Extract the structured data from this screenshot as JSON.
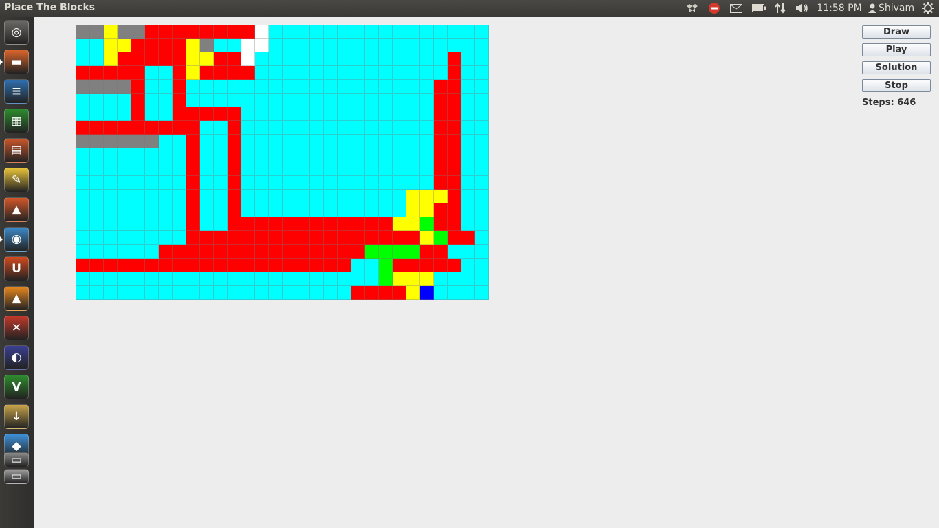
{
  "window": {
    "title": "Place The Blocks"
  },
  "tray": {
    "time": "11:58 PM",
    "user": "Shivam",
    "icons": [
      "dropbox-icon",
      "stop-icon",
      "mail-icon",
      "battery-icon",
      "network-icon",
      "volume-icon",
      "user-icon",
      "power-icon"
    ]
  },
  "launcher": {
    "apps": [
      {
        "name": "dash-home",
        "glyph": "◎",
        "color": "#6b6a66"
      },
      {
        "name": "files",
        "glyph": "▬",
        "color": "#d9642b"
      },
      {
        "name": "libreoffice-writer",
        "glyph": "≡",
        "color": "#2f6fb0"
      },
      {
        "name": "libreoffice-calc",
        "glyph": "▦",
        "color": "#2e8b2e"
      },
      {
        "name": "libreoffice-impress",
        "glyph": "▤",
        "color": "#c8562a"
      },
      {
        "name": "sticky-notes",
        "glyph": "✎",
        "color": "#e6c23a"
      },
      {
        "name": "software-center",
        "glyph": "▲",
        "color": "#d3582a"
      },
      {
        "name": "chromium",
        "glyph": "◉",
        "color": "#3c8ac9"
      },
      {
        "name": "ubuntu-one",
        "glyph": "U",
        "color": "#d04a1f"
      },
      {
        "name": "vlc",
        "glyph": "▲",
        "color": "#e8871e"
      },
      {
        "name": "system-settings",
        "glyph": "✕",
        "color": "#c0392b"
      },
      {
        "name": "eclipse",
        "glyph": "◐",
        "color": "#3a3f8f"
      },
      {
        "name": "vim",
        "glyph": "V",
        "color": "#2e8b2e"
      },
      {
        "name": "archive-manager",
        "glyph": "↓",
        "color": "#c9a44a"
      },
      {
        "name": "dropbox",
        "glyph": "◆",
        "color": "#3d8fd6"
      },
      {
        "name": "terminal",
        "glyph": "▭",
        "color": "#8a8a8a"
      },
      {
        "name": "text-editor",
        "glyph": "▭",
        "color": "#a0a0a0"
      }
    ]
  },
  "palette": {
    "G": "#808080",
    "Y": "#ffff00",
    "R": "#ff0000",
    "W": "#ffffff",
    "C": "#00ffff",
    "L": "#00ff00",
    "B": "#0000ff"
  },
  "board": {
    "rows": [
      "GGYGGRRRRRRRRWCCCCCCCCCCCCCCCC",
      "CCYYRRRRYGCCWWCCCCCCCCCCCCCCCC",
      "CCYRRRRRYYRRWCCCCCCCCCCCCCCRCC",
      "RRRRRCCRYRRRRCCCCCCCCCCCCCCRCC",
      "GGGGRCCRCCCCCCCCCCCCCCCCCCRRCC",
      "CCCCRCCRCCCCCCCCCCCCCCCCCCRRCC",
      "CCCCRCCRRRRRCCCCCCCCCCCCCCRRCC",
      "RRRRRRRRRCCRCCCCCCCCCCCCCCRRCC",
      "GGGGGGCCRCCRCCCCCCCCCCCCCCRRCC",
      "CCCCCCCCRCCRCCCCCCCCCCCCCCRRCC",
      "CCCCCCCCRCCRCCCCCCCCCCCCCCRRCC",
      "CCCCCCCCRCCRCCCCCCCCCCCCCCRRCC",
      "CCCCCCCCRCCRCCCCCCCCCCCCYYYRCC",
      "CCCCCCCCRCCRCCCCCCCCCCCCYYRRCC",
      "CCCCCCCCRCCRRRRRRRRRRRRYYLRRCC",
      "CCCCCCCCRRRRRRRRRRRRRRRRRYLRRCC",
      "CCCCCCRRRRRRRRRRRRRRRLLLLRRCC",
      "RRRRRRRRRRRRRRRRRRRRCCLRRRRRCC",
      "CCCCCCCCCCCCCCCCCCCCCCLYYYCCCC",
      "CCCCCCCCCCCCCCCCCCCCRRRRYBCCCC"
    ]
  },
  "controls": {
    "draw_label": "Draw",
    "play_label": "Play",
    "solution_label": "Solution",
    "stop_label": "Stop",
    "steps_label": "Steps: 646"
  }
}
